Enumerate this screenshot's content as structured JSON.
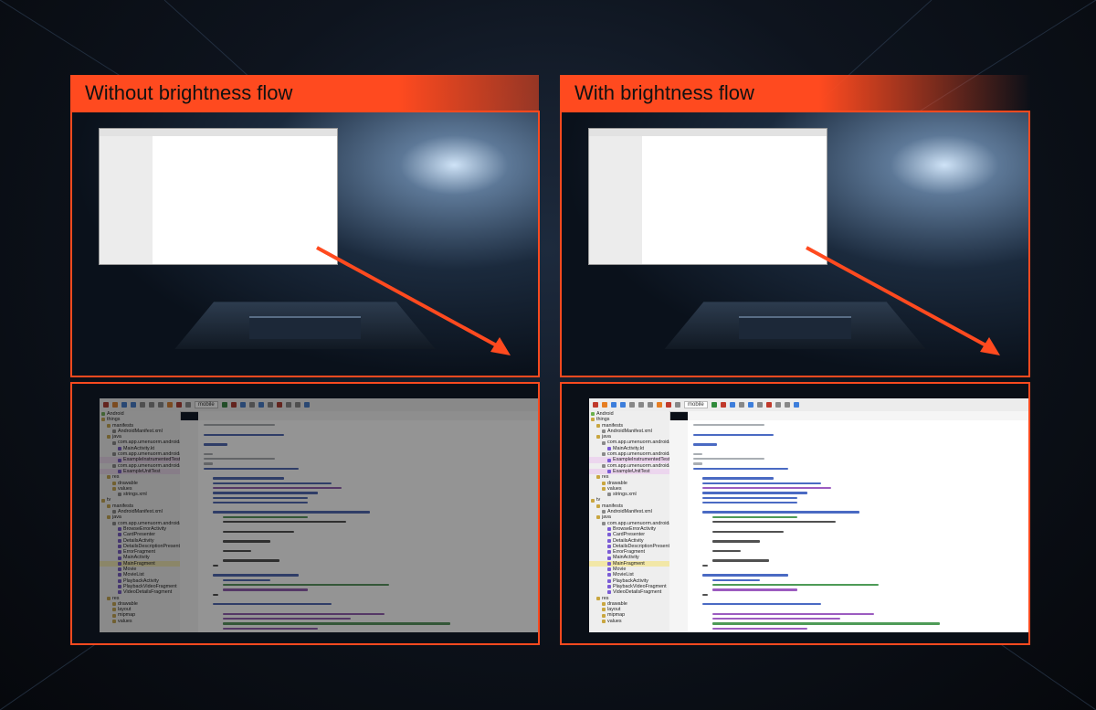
{
  "left_panel": {
    "title": "Without brightness flow",
    "mode": "dim"
  },
  "right_panel": {
    "title": "With brightness flow",
    "mode": "bright"
  },
  "colors": {
    "accent": "#ff4a1f",
    "frame": "#ff4a1f"
  },
  "ide": {
    "run_config": "mobile",
    "file_tab": "automotive_app_desc.xml",
    "project_tree": [
      {
        "label": "Android",
        "level": 0,
        "icon": "android-icon"
      },
      {
        "label": "things",
        "level": 0,
        "icon": "folder-icon"
      },
      {
        "label": "manifests",
        "level": 1,
        "icon": "folder-icon"
      },
      {
        "label": "AndroidManifest.xml",
        "level": 2,
        "icon": "file-icon"
      },
      {
        "label": "java",
        "level": 1,
        "icon": "folder-icon"
      },
      {
        "label": "com.app.umenuorm.androidap",
        "level": 2,
        "icon": "package-icon"
      },
      {
        "label": "MainActivity.kt",
        "level": 3,
        "icon": "kotlin-file-icon"
      },
      {
        "label": "com.app.umenuorm.androidap",
        "level": 2,
        "icon": "package-icon"
      },
      {
        "label": "ExampleInstrumentedTest",
        "level": 3,
        "icon": "kotlin-file-icon",
        "highlight": "hl2"
      },
      {
        "label": "com.app.umenuorm.androidap",
        "level": 2,
        "icon": "package-icon"
      },
      {
        "label": "ExampleUnitTest",
        "level": 3,
        "icon": "kotlin-file-icon",
        "highlight": "hl2"
      },
      {
        "label": "res",
        "level": 1,
        "icon": "folder-icon"
      },
      {
        "label": "drawable",
        "level": 2,
        "icon": "folder-icon"
      },
      {
        "label": "values",
        "level": 2,
        "icon": "folder-icon"
      },
      {
        "label": "strings.xml",
        "level": 3,
        "icon": "file-icon"
      },
      {
        "label": "tv",
        "level": 0,
        "icon": "folder-icon"
      },
      {
        "label": "manifests",
        "level": 1,
        "icon": "folder-icon"
      },
      {
        "label": "AndroidManifest.xml",
        "level": 2,
        "icon": "file-icon"
      },
      {
        "label": "java",
        "level": 1,
        "icon": "folder-icon"
      },
      {
        "label": "com.app.umenuorm.androidap",
        "level": 2,
        "icon": "package-icon"
      },
      {
        "label": "BrowseErrorActivity",
        "level": 3,
        "icon": "kotlin-file-icon"
      },
      {
        "label": "CardPresenter",
        "level": 3,
        "icon": "kotlin-file-icon"
      },
      {
        "label": "DetailsActivity",
        "level": 3,
        "icon": "kotlin-file-icon"
      },
      {
        "label": "DetailsDescriptionPresenter",
        "level": 3,
        "icon": "kotlin-file-icon"
      },
      {
        "label": "ErrorFragment",
        "level": 3,
        "icon": "kotlin-file-icon"
      },
      {
        "label": "MainActivity",
        "level": 3,
        "icon": "kotlin-file-icon"
      },
      {
        "label": "MainFragment",
        "level": 3,
        "icon": "kotlin-file-icon",
        "highlight": "hl"
      },
      {
        "label": "Movie",
        "level": 3,
        "icon": "kotlin-file-icon"
      },
      {
        "label": "MovieList",
        "level": 3,
        "icon": "kotlin-file-icon"
      },
      {
        "label": "PlaybackActivity",
        "level": 3,
        "icon": "kotlin-file-icon"
      },
      {
        "label": "PlaybackVideoFragment",
        "level": 3,
        "icon": "kotlin-file-icon"
      },
      {
        "label": "VideoDetailsFragment",
        "level": 3,
        "icon": "kotlin-file-icon"
      },
      {
        "label": "res",
        "level": 1,
        "icon": "folder-icon"
      },
      {
        "label": "drawable",
        "level": 2,
        "icon": "folder-icon"
      },
      {
        "label": "layout",
        "level": 2,
        "icon": "folder-icon"
      },
      {
        "label": "mipmap",
        "level": 2,
        "icon": "folder-icon"
      },
      {
        "label": "values",
        "level": 2,
        "icon": "folder-icon"
      }
    ],
    "code_rows": [
      {
        "indent": 0,
        "len": 30,
        "color": "#9aa0a6"
      },
      {
        "indent": 0,
        "len": 0,
        "color": "#ffffff"
      },
      {
        "indent": 0,
        "len": 34,
        "color": "#2a50b8"
      },
      {
        "indent": 0,
        "len": 0,
        "color": "#ffffff"
      },
      {
        "indent": 0,
        "len": 10,
        "color": "#2a50b8"
      },
      {
        "indent": 0,
        "len": 0,
        "color": "#ffffff"
      },
      {
        "indent": 0,
        "len": 4,
        "color": "#9aa0a6"
      },
      {
        "indent": 0,
        "len": 30,
        "color": "#9aa0a6"
      },
      {
        "indent": 0,
        "len": 4,
        "color": "#9aa0a6"
      },
      {
        "indent": 0,
        "len": 40,
        "color": "#2a50b8"
      },
      {
        "indent": 0,
        "len": 0,
        "color": "#ffffff"
      },
      {
        "indent": 4,
        "len": 30,
        "color": "#2a50b8"
      },
      {
        "indent": 4,
        "len": 50,
        "color": "#2a50b8"
      },
      {
        "indent": 4,
        "len": 54,
        "color": "#8b3fb5"
      },
      {
        "indent": 4,
        "len": 44,
        "color": "#2a50b8"
      },
      {
        "indent": 4,
        "len": 40,
        "color": "#2a50b8"
      },
      {
        "indent": 4,
        "len": 40,
        "color": "#2a50b8"
      },
      {
        "indent": 0,
        "len": 0,
        "color": "#ffffff"
      },
      {
        "indent": 4,
        "len": 66,
        "color": "#2a50b8"
      },
      {
        "indent": 8,
        "len": 36,
        "color": "#2f8a3a"
      },
      {
        "indent": 8,
        "len": 52,
        "color": "#333333"
      },
      {
        "indent": 0,
        "len": 0,
        "color": "#ffffff"
      },
      {
        "indent": 8,
        "len": 30,
        "color": "#333333"
      },
      {
        "indent": 0,
        "len": 0,
        "color": "#ffffff"
      },
      {
        "indent": 8,
        "len": 20,
        "color": "#333333"
      },
      {
        "indent": 0,
        "len": 0,
        "color": "#ffffff"
      },
      {
        "indent": 8,
        "len": 12,
        "color": "#333333"
      },
      {
        "indent": 0,
        "len": 0,
        "color": "#ffffff"
      },
      {
        "indent": 8,
        "len": 24,
        "color": "#333333"
      },
      {
        "indent": 4,
        "len": 2,
        "color": "#333333"
      },
      {
        "indent": 0,
        "len": 0,
        "color": "#ffffff"
      },
      {
        "indent": 4,
        "len": 36,
        "color": "#2a50b8"
      },
      {
        "indent": 8,
        "len": 20,
        "color": "#2a50b8"
      },
      {
        "indent": 8,
        "len": 70,
        "color": "#2f8a3a"
      },
      {
        "indent": 8,
        "len": 36,
        "color": "#8b3fb5"
      },
      {
        "indent": 4,
        "len": 2,
        "color": "#333333"
      },
      {
        "indent": 0,
        "len": 0,
        "color": "#ffffff"
      },
      {
        "indent": 4,
        "len": 50,
        "color": "#2a50b8"
      },
      {
        "indent": 0,
        "len": 0,
        "color": "#ffffff"
      },
      {
        "indent": 8,
        "len": 68,
        "color": "#8b3fb5"
      },
      {
        "indent": 8,
        "len": 54,
        "color": "#8b3fb5"
      },
      {
        "indent": 8,
        "len": 96,
        "color": "#2f8a3a"
      },
      {
        "indent": 8,
        "len": 40,
        "color": "#8b3fb5"
      },
      {
        "indent": 8,
        "len": 70,
        "color": "#8b3fb5"
      }
    ]
  }
}
